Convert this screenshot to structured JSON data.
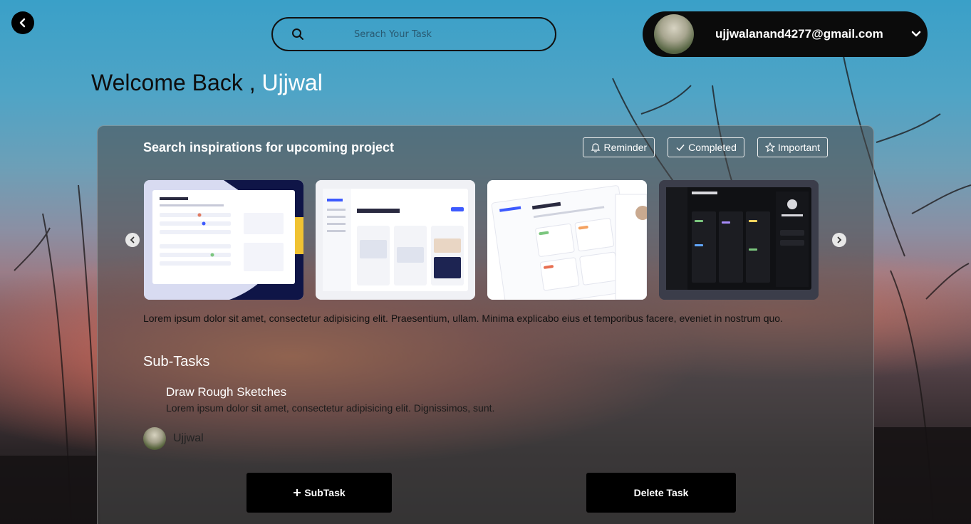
{
  "header": {
    "search_placeholder": "Serach Your Task",
    "account_email": "ujjwalanand4277@gmail.com"
  },
  "welcome": {
    "prefix": "Welcome Back , ",
    "name": "Ujjwal"
  },
  "card": {
    "title": "Search inspirations for upcoming project",
    "tags": [
      {
        "label": "Reminder",
        "icon": "bell-icon"
      },
      {
        "label": "Completed",
        "icon": "check-icon"
      },
      {
        "label": "Important",
        "icon": "star-icon"
      }
    ],
    "description": "Lorem ipsum dolor sit amet, consectetur adipisicing elit. Praesentium, ullam. Minima explicabo eius et temporibus facere, eveniet in nostrum quo.",
    "subtasks_title": "Sub-Tasks",
    "subtask": {
      "name": "Draw Rough Sketches",
      "description": "Lorem ipsum dolor sit amet, consectetur adipisicing elit. Dignissimos, sunt."
    },
    "assignee": "Ujjwal",
    "buttons": {
      "add_subtask": "SubTask",
      "delete_task": "Delete Task"
    }
  },
  "icons": {
    "back": "back-arrow-icon",
    "search": "search-icon",
    "dropdown": "chevron-down-icon",
    "carousel_prev": "chevron-left-icon",
    "carousel_next": "chevron-right-icon",
    "plus": "plus-icon"
  },
  "colors": {
    "accent_name": "#ffffff",
    "button_bg": "#000000",
    "account_bg": "#0b0b0b"
  }
}
